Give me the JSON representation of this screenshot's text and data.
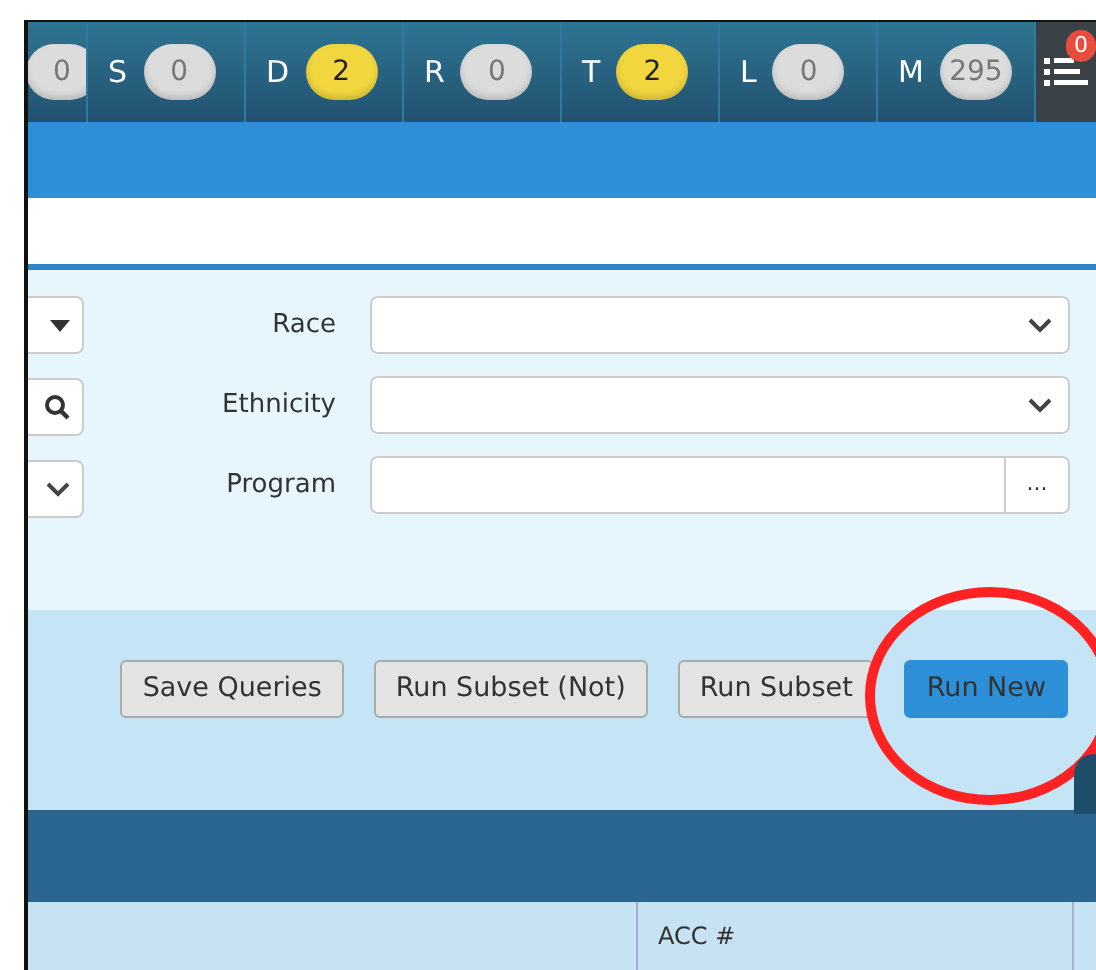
{
  "status_tabs": [
    {
      "count": "0",
      "color": "#dcdcdc"
    },
    {
      "letter": "S",
      "count": "0",
      "color": "#dcdcdc"
    },
    {
      "letter": "D",
      "count": "2",
      "color": "#f2d640"
    },
    {
      "letter": "R",
      "count": "0",
      "color": "#dcdcdc"
    },
    {
      "letter": "T",
      "count": "2",
      "color": "#f2d640"
    },
    {
      "letter": "L",
      "count": "0",
      "color": "#dcdcdc"
    },
    {
      "letter": "M",
      "count": "295",
      "color": "#dcdcdc"
    }
  ],
  "menu": {
    "badge": "0"
  },
  "left_controls": [
    {
      "kind": "dropdown"
    },
    {
      "kind": "search"
    },
    {
      "kind": "select"
    }
  ],
  "fields": [
    {
      "label": "Race",
      "kind": "select"
    },
    {
      "label": "Ethnicity",
      "kind": "select"
    },
    {
      "label": "Program",
      "kind": "picker",
      "button": "..."
    }
  ],
  "buttons": [
    {
      "label": "Save Queries",
      "primary": false
    },
    {
      "label": "Run Subset (Not)",
      "primary": false
    },
    {
      "label": "Run Subset",
      "primary": false
    },
    {
      "label": "Run New",
      "primary": true
    }
  ],
  "table": {
    "columns": [
      "ACC #"
    ]
  }
}
